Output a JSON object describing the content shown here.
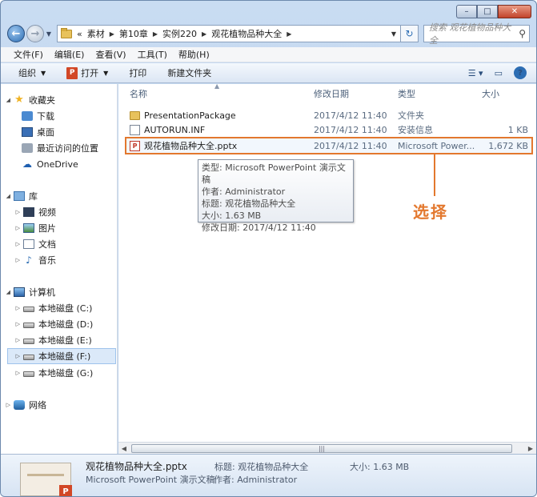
{
  "window": {
    "minimize": "–",
    "maximize": "□",
    "close": "✕"
  },
  "address": {
    "overflow": "«",
    "crumbs": [
      "素材",
      "第10章",
      "实例220",
      "观花植物品种大全"
    ],
    "search_placeholder": "搜索 观花植物品种大全"
  },
  "menu": [
    "文件(F)",
    "编辑(E)",
    "查看(V)",
    "工具(T)",
    "帮助(H)"
  ],
  "toolbar": {
    "organize": "组织",
    "open": "打开",
    "print": "打印",
    "new_folder": "新建文件夹"
  },
  "nav": {
    "favorites": "收藏夹",
    "downloads": "下载",
    "desktop": "桌面",
    "recent": "最近访问的位置",
    "onedrive": "OneDrive",
    "libraries": "库",
    "videos": "视频",
    "pictures": "图片",
    "documents": "文档",
    "music": "音乐",
    "computer": "计算机",
    "drives": [
      "本地磁盘 (C:)",
      "本地磁盘 (D:)",
      "本地磁盘 (E:)",
      "本地磁盘 (F:)",
      "本地磁盘 (G:)"
    ],
    "network": "网络"
  },
  "columns": {
    "name": "名称",
    "date": "修改日期",
    "type": "类型",
    "size": "大小"
  },
  "files": [
    {
      "name": "PresentationPackage",
      "date": "2017/4/12 11:40",
      "type": "文件夹",
      "size": ""
    },
    {
      "name": "AUTORUN.INF",
      "date": "2017/4/12 11:40",
      "type": "安装信息",
      "size": "1 KB"
    },
    {
      "name": "观花植物品种大全.pptx",
      "date": "2017/4/12 11:40",
      "type": "Microsoft Power...",
      "size": "1,672 KB"
    }
  ],
  "tooltip": [
    "类型: Microsoft PowerPoint 演示文稿",
    "作者: Administrator",
    "标题: 观花植物品种大全",
    "大小: 1.63 MB",
    "修改日期: 2017/4/12 11:40"
  ],
  "annotation": "选择",
  "details": {
    "filename": "观花植物品种大全.pptx",
    "filetype": "Microsoft PowerPoint 演示文稿",
    "title": "标题: 观花植物品种大全",
    "author": "作者: Administrator",
    "size": "大小: 1.63 MB"
  },
  "colors": {
    "annotation": "#e3782e",
    "selection": "#dbe9f9"
  }
}
